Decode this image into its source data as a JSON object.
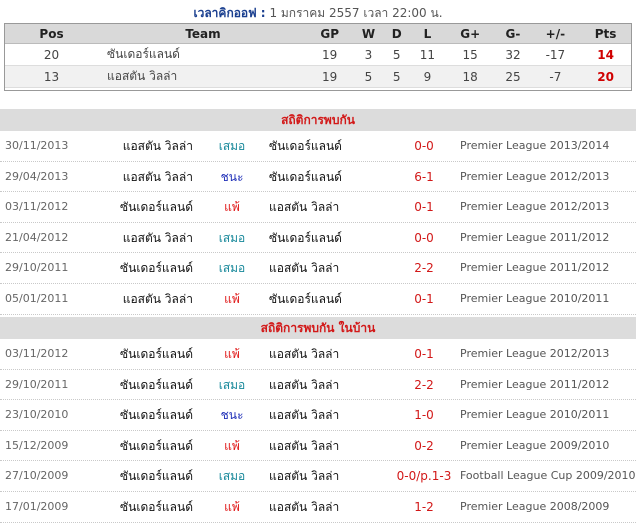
{
  "kickoff": {
    "label": "เวลาคิกออฟ :",
    "value": "1 มกราคม 2557 เวลา 22:00 น."
  },
  "standings": {
    "headers": [
      "Pos",
      "Team",
      "GP",
      "W",
      "D",
      "L",
      "G+",
      "G-",
      "+/-",
      "Pts"
    ],
    "rows": [
      {
        "pos": "20",
        "team": "ซันเดอร์แลนด์",
        "gp": "19",
        "w": "3",
        "d": "5",
        "l": "11",
        "gf": "15",
        "ga": "32",
        "gd": "-17",
        "pts": "14"
      },
      {
        "pos": "13",
        "team": "แอสตัน วิลล่า",
        "gp": "19",
        "w": "5",
        "d": "5",
        "l": "9",
        "gf": "18",
        "ga": "25",
        "gd": "-7",
        "pts": "20"
      }
    ]
  },
  "head_to_head": {
    "title": "สถิติการพบกัน",
    "matches": [
      {
        "date": "30/11/2013",
        "home": "แอสตัน วิลล่า",
        "result": "เสมอ",
        "away": "ซันเดอร์แลนด์",
        "score": "0-0",
        "competition": "Premier League 2013/2014"
      },
      {
        "date": "29/04/2013",
        "home": "แอสตัน วิลล่า",
        "result": "ชนะ",
        "away": "ซันเดอร์แลนด์",
        "score": "6-1",
        "competition": "Premier League 2012/2013"
      },
      {
        "date": "03/11/2012",
        "home": "ซันเดอร์แลนด์",
        "result": "แพ้",
        "away": "แอสตัน วิลล่า",
        "score": "0-1",
        "competition": "Premier League 2012/2013"
      },
      {
        "date": "21/04/2012",
        "home": "แอสตัน วิลล่า",
        "result": "เสมอ",
        "away": "ซันเดอร์แลนด์",
        "score": "0-0",
        "competition": "Premier League 2011/2012"
      },
      {
        "date": "29/10/2011",
        "home": "ซันเดอร์แลนด์",
        "result": "เสมอ",
        "away": "แอสตัน วิลล่า",
        "score": "2-2",
        "competition": "Premier League 2011/2012"
      },
      {
        "date": "05/01/2011",
        "home": "แอสตัน วิลล่า",
        "result": "แพ้",
        "away": "ซันเดอร์แลนด์",
        "score": "0-1",
        "competition": "Premier League 2010/2011"
      }
    ]
  },
  "home_head_to_head": {
    "title": "สถิติการพบกัน ในบ้าน",
    "matches": [
      {
        "date": "03/11/2012",
        "home": "ซันเดอร์แลนด์",
        "result": "แพ้",
        "away": "แอสตัน วิลล่า",
        "score": "0-1",
        "competition": "Premier League 2012/2013"
      },
      {
        "date": "29/10/2011",
        "home": "ซันเดอร์แลนด์",
        "result": "เสมอ",
        "away": "แอสตัน วิลล่า",
        "score": "2-2",
        "competition": "Premier League 2011/2012"
      },
      {
        "date": "23/10/2010",
        "home": "ซันเดอร์แลนด์",
        "result": "ชนะ",
        "away": "แอสตัน วิลล่า",
        "score": "1-0",
        "competition": "Premier League 2010/2011"
      },
      {
        "date": "15/12/2009",
        "home": "ซันเดอร์แลนด์",
        "result": "แพ้",
        "away": "แอสตัน วิลล่า",
        "score": "0-2",
        "competition": "Premier League 2009/2010"
      },
      {
        "date": "27/10/2009",
        "home": "ซันเดอร์แลนด์",
        "result": "เสมอ",
        "away": "แอสตัน วิลล่า",
        "score": "0-0/p.1-3",
        "competition": "Football League Cup 2009/2010"
      },
      {
        "date": "17/01/2009",
        "home": "ซันเดอร์แลนด์",
        "result": "แพ้",
        "away": "แอสตัน วิลล่า",
        "score": "1-2",
        "competition": "Premier League 2008/2009"
      }
    ]
  },
  "colors": {
    "result_draw": "#17889a",
    "result_win": "#1f2fb8",
    "result_loss": "#e01818",
    "section_title": "#d21818",
    "points": "#d00000"
  }
}
